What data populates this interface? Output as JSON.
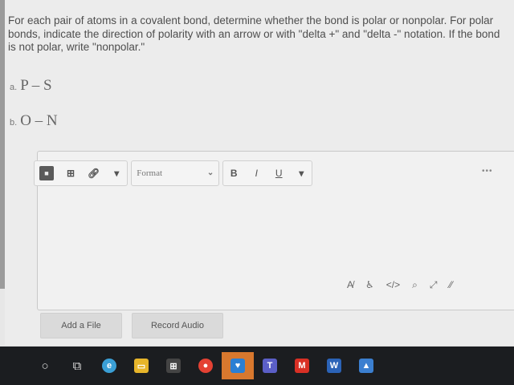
{
  "question": {
    "prompt": "For each pair of atoms in a covalent bond, determine whether the bond is polar or nonpolar. For polar bonds, indicate the direction of polarity with an arrow or with \"delta +\" and \"delta -\" notation. If the bond is not polar, write \"nonpolar.\"",
    "parts": [
      {
        "label": "a.",
        "formula": "P – S"
      },
      {
        "label": "b.",
        "formula": "O – N"
      }
    ]
  },
  "editor": {
    "toolbar": {
      "format_label": "Format",
      "bold_label": "B",
      "italic_label": "I",
      "underline_label": "U"
    },
    "bottom_icons": [
      "spellcheck-icon",
      "accessibility-icon",
      "code-icon",
      "find-icon",
      "fullscreen-icon",
      "resize-icon"
    ]
  },
  "buttons": {
    "add_file": "Add a File",
    "record_audio": "Record Audio"
  },
  "taskbar": {
    "items": [
      "search-icon",
      "task-view-icon",
      "edge-icon",
      "file-explorer-icon",
      "store-icon",
      "chrome-icon",
      "security-app-icon",
      "teams-icon",
      "gmail-icon",
      "word-icon",
      "photos-icon"
    ],
    "colors": {
      "edge": "#3a9fd6",
      "explorer": "#e7b52a",
      "chrome": "#e44133",
      "security": "#2a7fd4",
      "teams": "#5b5fc7",
      "gmail": "#d93025",
      "word": "#2b63b7",
      "photos": "#3b7fd0"
    }
  }
}
